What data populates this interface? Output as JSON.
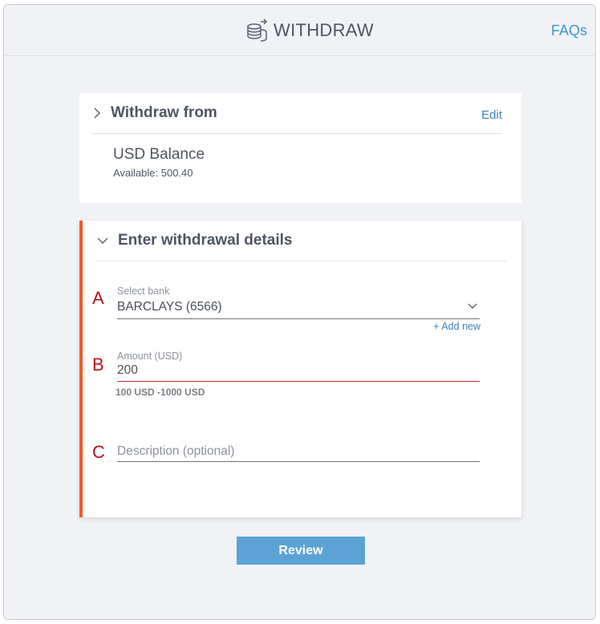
{
  "header": {
    "title": "WITHDRAW",
    "title_icon": "coins-stack-icon",
    "faqs_label": "FAQs"
  },
  "withdraw_from": {
    "heading": "Withdraw from",
    "edit_label": "Edit",
    "balance_name": "USD Balance",
    "available_text": "Available: 500.40"
  },
  "details": {
    "heading": "Enter withdrawal details",
    "markers": {
      "a": "A",
      "b": "B",
      "c": "C"
    },
    "bank": {
      "label": "Select bank",
      "value": "BARCLAYS (6566)",
      "add_new_label": "+ Add new"
    },
    "amount": {
      "label": "Amount (USD)",
      "value": "200",
      "range_hint": "100 USD -1000 USD"
    },
    "description": {
      "placeholder": "Description (optional)",
      "value": ""
    }
  },
  "actions": {
    "review_label": "Review"
  },
  "colors": {
    "accent_blue": "#5aa3d4",
    "link_blue": "#3d7fb6",
    "active_bar": "#ef5a24",
    "error_red": "#c0262d",
    "marker_red": "#b8101f"
  }
}
